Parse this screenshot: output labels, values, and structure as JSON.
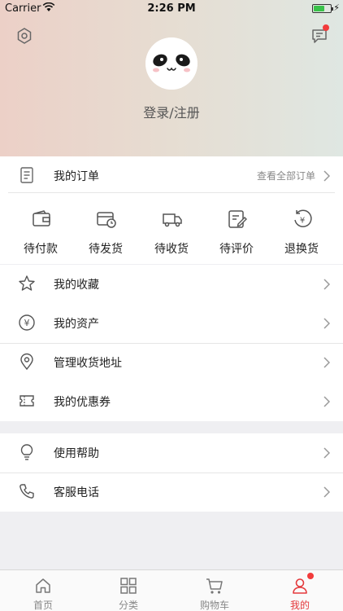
{
  "status_bar": {
    "carrier": "Carrier",
    "time": "2:26 PM"
  },
  "header": {
    "login_text": "登录/注册"
  },
  "orders": {
    "title": "我的订单",
    "view_all": "查看全部订单",
    "items": [
      {
        "label": "待付款",
        "icon": "wallet-icon"
      },
      {
        "label": "待发货",
        "icon": "card-clock-icon"
      },
      {
        "label": "待收货",
        "icon": "truck-icon"
      },
      {
        "label": "待评价",
        "icon": "review-edit-icon"
      },
      {
        "label": "退换货",
        "icon": "refund-icon"
      }
    ]
  },
  "menu": {
    "favorites": "我的收藏",
    "assets": "我的资产",
    "address": "管理收货地址",
    "coupons": "我的优惠券"
  },
  "support": {
    "help": "使用帮助",
    "service": "客服电话"
  },
  "tabbar": {
    "tabs": [
      {
        "label": "首页",
        "icon": "home-icon"
      },
      {
        "label": "分类",
        "icon": "grid-icon"
      },
      {
        "label": "购物车",
        "icon": "cart-icon"
      },
      {
        "label": "我的",
        "icon": "user-icon",
        "active": true
      }
    ]
  },
  "colors": {
    "accent": "#e4393c",
    "badge": "#f23b3b"
  }
}
